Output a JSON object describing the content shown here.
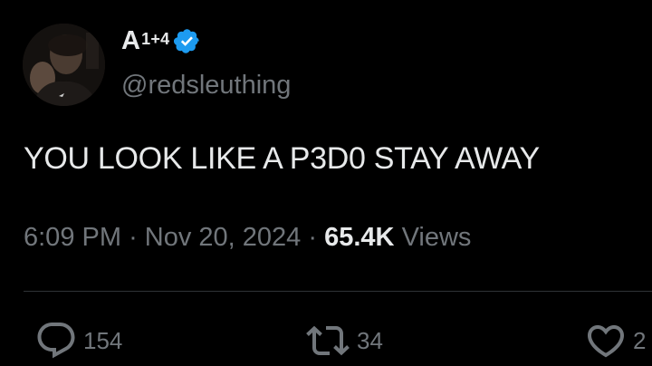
{
  "author": {
    "display_name": "A",
    "display_name_sup": "1+4",
    "handle": "@redsleuthing",
    "verified": true
  },
  "tweet": {
    "text": "YOU LOOK LIKE A P3D0 STAY AWAY",
    "time": "6:09 PM",
    "separator": "·",
    "date": "Nov 20, 2024",
    "views_count": "65.4K",
    "views_label": "Views"
  },
  "actions": {
    "reply_count": "154",
    "repost_count": "34",
    "like_count": "2"
  },
  "colors": {
    "background": "#000000",
    "text_primary": "#e7e9ea",
    "text_secondary": "#71767b",
    "verified_blue": "#1d9bf0",
    "divider": "#2f3336"
  },
  "icons": {
    "verified": "verified-badge-icon",
    "reply": "reply-icon",
    "repost": "repost-icon",
    "like": "heart-icon"
  }
}
